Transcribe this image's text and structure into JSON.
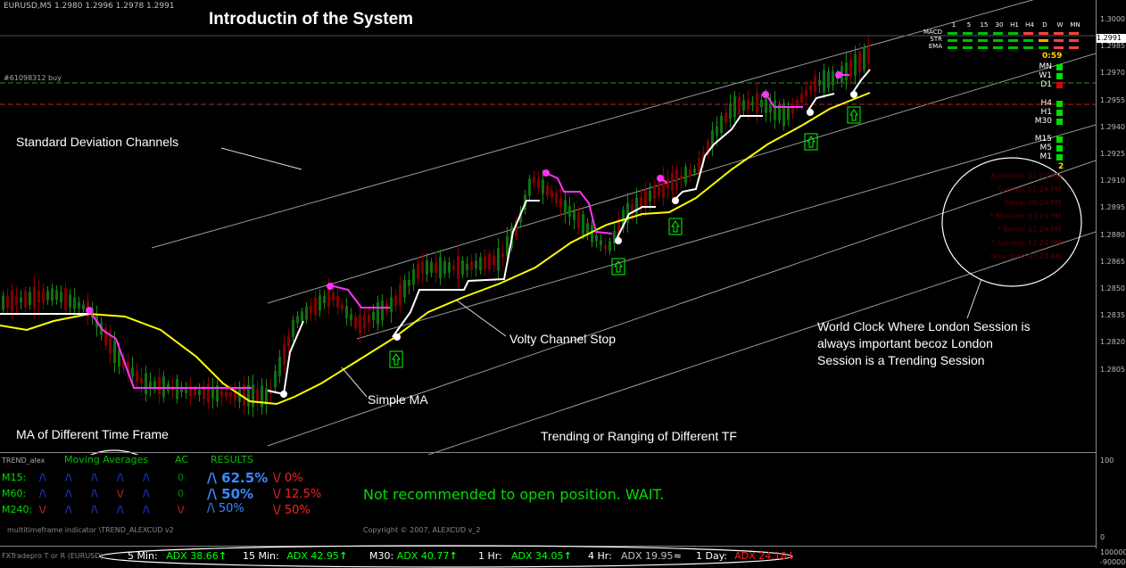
{
  "symbol_header": "EURUSD,M5  1.2980 1.2996 1.2978 1.2991",
  "title": "Introductin of the System",
  "order_label": "#61098312 buy",
  "annotations": {
    "std_dev": "Standard Deviation Channels",
    "volty": "Volty Channel Stop",
    "simple_ma": "Simple MA",
    "ma_tf": "MA of Different Time Frame",
    "trend_tf": "Trending or Ranging of Different TF",
    "world_clock": [
      "World Clock Where London Session is",
      "always important becoz London",
      "Session is a Trending Session"
    ]
  },
  "price_axis": {
    "current": "1.2991",
    "ticks": [
      "1.3000",
      "1.2985",
      "1.2970",
      "1.2955",
      "1.2940",
      "1.2925",
      "1.2910",
      "1.2895",
      "1.2880",
      "1.2865",
      "1.2850",
      "1.2835",
      "1.2820",
      "1.2805"
    ],
    "subwindow_top": "100",
    "subwindow_zero": "0",
    "bottom_top": "1000000",
    "bottom_low": "-900000"
  },
  "signal_grid": {
    "timeframes": [
      "1",
      "5",
      "15",
      "30",
      "H1",
      "H4",
      "D",
      "W",
      "MN"
    ],
    "rows": [
      {
        "label": "MACD",
        "colors": [
          "#00c000",
          "#00c000",
          "#00c000",
          "#00c000",
          "#00c000",
          "#ff4040",
          "#ff4040",
          "#ff4040",
          "#ff4040"
        ]
      },
      {
        "label": "STR",
        "colors": [
          "#00c000",
          "#00c000",
          "#00c000",
          "#00c000",
          "#00c000",
          "#00c000",
          "#ffa500",
          "#ff4040",
          "#ff4040"
        ]
      },
      {
        "label": "EMA",
        "colors": [
          "#00c000",
          "#00c000",
          "#00c000",
          "#00c000",
          "#00c000",
          "#00c000",
          "#00c000",
          "#ff4040",
          "#ff4040"
        ]
      }
    ]
  },
  "candle_timer": "0:59",
  "tf_status": [
    {
      "label": "MN",
      "color": "#00e000"
    },
    {
      "label": "W1",
      "color": "#00e000"
    },
    {
      "label": "D1",
      "color": "#e00000"
    },
    {
      "label": "H4",
      "color": "#00e000"
    },
    {
      "label": "H1",
      "color": "#00e000"
    },
    {
      "label": "M30",
      "color": "#00e000"
    },
    {
      "label": "M15",
      "color": "#00e000"
    },
    {
      "label": "M5",
      "color": "#00e000"
    },
    {
      "label": "M1",
      "color": "#00e000"
    }
  ],
  "tf_count": "2",
  "clock": [
    {
      "city": "Auckland:",
      "time": "01:24 AM"
    },
    {
      "city": "Sydney:",
      "time": "11:24 PM"
    },
    {
      "city": "Tokyo:",
      "time": "09:24 PM"
    },
    {
      "city": "* Moscow:",
      "time": "03:24 PM"
    },
    {
      "city": "* Berlin:",
      "time": "01:24 PM"
    },
    {
      "city": "* London:",
      "time": "12:24 PM"
    },
    {
      "city": "New York:",
      "time": "07:24 AM"
    }
  ],
  "subwindow": {
    "name": "TREND_alex",
    "headers": {
      "ma": "Moving Averages",
      "ac": "AC",
      "results": "RESULTS"
    },
    "rows": [
      {
        "label": "M15:",
        "arrows": [
          "/\\",
          "/\\",
          "/\\",
          "/\\",
          "/\\"
        ],
        "arrow_colors": [
          "#2040ff",
          "#2040ff",
          "#2040ff",
          "#2040ff",
          "#2040ff"
        ],
        "ac": "0",
        "ac_color": "#008000",
        "up": "/\\ 62.5%",
        "down": "\\/ 0%"
      },
      {
        "label": "M60:",
        "arrows": [
          "/\\",
          "/\\",
          "/\\",
          "\\/",
          "/\\"
        ],
        "arrow_colors": [
          "#2040ff",
          "#2040ff",
          "#2040ff",
          "#ff2020",
          "#2040ff"
        ],
        "ac": "0",
        "ac_color": "#008000",
        "up": "/\\ 50%",
        "down": "\\/ 12.5%"
      },
      {
        "label": "M240:",
        "arrows": [
          "\\/",
          "/\\",
          "/\\",
          "/\\",
          "/\\"
        ],
        "arrow_colors": [
          "#ff2020",
          "#2040ff",
          "#2040ff",
          "#2040ff",
          "#2040ff"
        ],
        "ac": "\\/",
        "ac_color": "#ff2020",
        "up": "/\\ 50%",
        "down": "\\/ 50%"
      }
    ],
    "message": "Not recommended to open position. WAIT.",
    "footer": "multitimeframe indicator \\TREND_ALEXCUD v2",
    "copyright": "Copyright © 2007, ALEXCUD v_2"
  },
  "bottom_bar": {
    "name": "FXTradepro T or R (EURUSD)",
    "items": [
      {
        "tf": "5 Min:",
        "val": "ADX 38.66",
        "color": "#00ff00",
        "mark": "↑"
      },
      {
        "tf": "15 Min:",
        "val": "ADX 42.95",
        "color": "#00ff00",
        "mark": "↑"
      },
      {
        "tf": "M30:",
        "val": "ADX 40.77",
        "color": "#00ff00",
        "mark": "↑"
      },
      {
        "tf": "1 Hr:",
        "val": "ADX 34.05",
        "color": "#00ff00",
        "mark": "↑"
      },
      {
        "tf": "4 Hr:",
        "val": "ADX 19.95",
        "color": "#c0c0c0",
        "mark": "≈"
      },
      {
        "tf": "1 Day:",
        "val": "ADX 24.18",
        "color": "#ff2020",
        "mark": "↓"
      }
    ]
  }
}
